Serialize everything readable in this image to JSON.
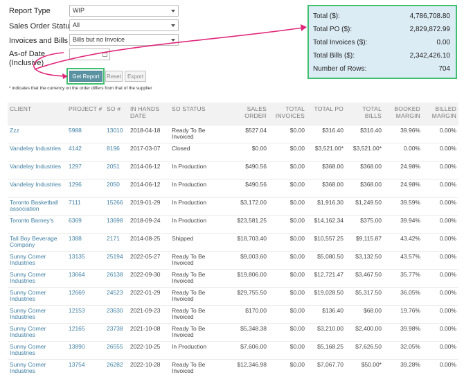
{
  "form": {
    "report_type": {
      "label": "Report Type",
      "value": "WIP"
    },
    "sales_order_status": {
      "label": "Sales Order Status",
      "value": "All"
    },
    "invoices_bills": {
      "label": "Invoices and Bills",
      "value": "Bills but no Invoice"
    },
    "as_of_date": {
      "label_line1": "As-of Date",
      "label_line2": "(Inclusive)",
      "value": ""
    },
    "buttons": {
      "get_report": "Get Report",
      "reset": "Reset",
      "export": "Export"
    },
    "note": "* indicates that the currency on the order differs from that of the supplier"
  },
  "summary": [
    {
      "label": "Total ($):",
      "value": "4,786,708.80"
    },
    {
      "label": "Total PO ($):",
      "value": "2,829,872.99"
    },
    {
      "label": "Total Invoices ($):",
      "value": "0.00"
    },
    {
      "label": "Total Bills ($):",
      "value": "2,342,426.10"
    },
    {
      "label": "Number of Rows:",
      "value": "704"
    }
  ],
  "table": {
    "headers": [
      "CLIENT",
      "PROJECT #",
      "SO #",
      "IN HANDS DATE",
      "SO STATUS",
      "SALES ORDER",
      "TOTAL INVOICES",
      "TOTAL PO",
      "TOTAL BILLS",
      "BOOKED MARGIN",
      "BILLED MARGIN"
    ],
    "rows": [
      [
        "Zzz",
        "5988",
        "13010",
        "2018-04-18",
        "Ready To Be Invoiced",
        "$527.04",
        "$0.00",
        "$316.40",
        "$316.40",
        "39.96%",
        "0.00%"
      ],
      [
        "Vandelay Industries",
        "4142",
        "8196",
        "2017-03-07",
        "Closed",
        "$0.00",
        "$0.00",
        "$3,521.00*",
        "$3,521.00*",
        "0.00%",
        "0.00%"
      ],
      [
        "Vandelay Industries",
        "1297",
        "2051",
        "2014-06-12",
        "In Production",
        "$490.56",
        "$0.00",
        "$368.00",
        "$368.00",
        "24.98%",
        "0.00%"
      ],
      [
        "Vandelay Industries",
        "1296",
        "2050",
        "2014-06-12",
        "In Production",
        "$490.56",
        "$0.00",
        "$368.00",
        "$368.00",
        "24.98%",
        "0.00%"
      ],
      [
        "Toronto Basketball association",
        "7111",
        "15266",
        "2019-01-29",
        "In Production",
        "$3,172.00",
        "$0.00",
        "$1,916.30",
        "$1,249.50",
        "39.59%",
        "0.00%"
      ],
      [
        "Toronto Barney's",
        "6369",
        "13698",
        "2018-09-24",
        "In Production",
        "$23,581.25",
        "$0.00",
        "$14,162.34",
        "$375.00",
        "39.94%",
        "0.00%"
      ],
      [
        "Tall Boy Beverage Company",
        "1388",
        "2171",
        "2014-08-25",
        "Shipped",
        "$18,703.40",
        "$0.00",
        "$10,557.25",
        "$9,115.87",
        "43.42%",
        "0.00%"
      ],
      [
        "Sunny Corner Industries",
        "13135",
        "25194",
        "2022-05-27",
        "Ready To Be Invoiced",
        "$9,003.60",
        "$0.00",
        "$5,080.50",
        "$3,132.50",
        "43.57%",
        "0.00%"
      ],
      [
        "Sunny Corner Industries",
        "13664",
        "26138",
        "2022-09-30",
        "Ready To Be Invoiced",
        "$19,806.00",
        "$0.00",
        "$12,721.47",
        "$3,467.50",
        "35.77%",
        "0.00%"
      ],
      [
        "Sunny Corner Industries",
        "12669",
        "24523",
        "2022-01-29",
        "Ready To Be Invoiced",
        "$29,755.50",
        "$0.00",
        "$19,028.50",
        "$5,317.50",
        "36.05%",
        "0.00%"
      ],
      [
        "Sunny Corner Industries",
        "12153",
        "23630",
        "2021-09-23",
        "Ready To Be Invoiced",
        "$170.00",
        "$0.00",
        "$136.40",
        "$68.00",
        "19.76%",
        "0.00%"
      ],
      [
        "Sunny Corner Industries",
        "12165",
        "23738",
        "2021-10-08",
        "Ready To Be Invoiced",
        "$5,348.38",
        "$0.00",
        "$3,210.00",
        "$2,400.00",
        "39.98%",
        "0.00%"
      ],
      [
        "Sunny Corner Industries",
        "13890",
        "26555",
        "2022-10-25",
        "In Production",
        "$7,606.00",
        "$0.00",
        "$5,168.25",
        "$7,626.50",
        "32.05%",
        "0.00%"
      ],
      [
        "Sunny Corner Industries",
        "13754",
        "26282",
        "2022-10-28",
        "Ready To Be Invoiced",
        "$12,346.98",
        "$0.00",
        "$7,067.70",
        "$50.00*",
        "39.28%",
        "0.00%"
      ]
    ]
  },
  "colors": {
    "accent_green": "#3fbf6f",
    "arrow_magenta": "#e0287a",
    "link_blue": "#3f7fa2",
    "button_teal": "#5b93a3",
    "summary_bg": "#dcecf5"
  }
}
